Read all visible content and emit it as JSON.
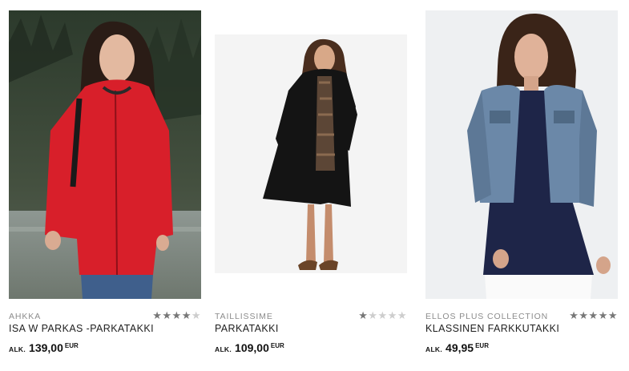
{
  "products": [
    {
      "brand": "AHKKA",
      "name": "ISA W PARKAS -PARKATAKKI",
      "price_prefix": "ALK.",
      "price": "139,00",
      "currency": "EUR",
      "rating": 4,
      "rating_max": 5,
      "image_description": "woman in red parka outdoors by a lake"
    },
    {
      "brand": "TAILLISSIME",
      "name": "PARKATAKKI",
      "price_prefix": "ALK.",
      "price": "109,00",
      "currency": "EUR",
      "rating": 1,
      "rating_max": 5,
      "image_description": "woman in black parka on white background"
    },
    {
      "brand": "ELLOS PLUS COLLECTION",
      "name": "KLASSINEN FARKKUTAKKI",
      "price_prefix": "ALK.",
      "price": "49,95",
      "currency": "EUR",
      "rating": 5,
      "rating_max": 5,
      "image_description": "woman in denim jacket on light background"
    }
  ],
  "colors": {
    "star_filled": "#777777",
    "star_empty": "#cdcdcd",
    "brand_text": "#8c8c8c"
  }
}
